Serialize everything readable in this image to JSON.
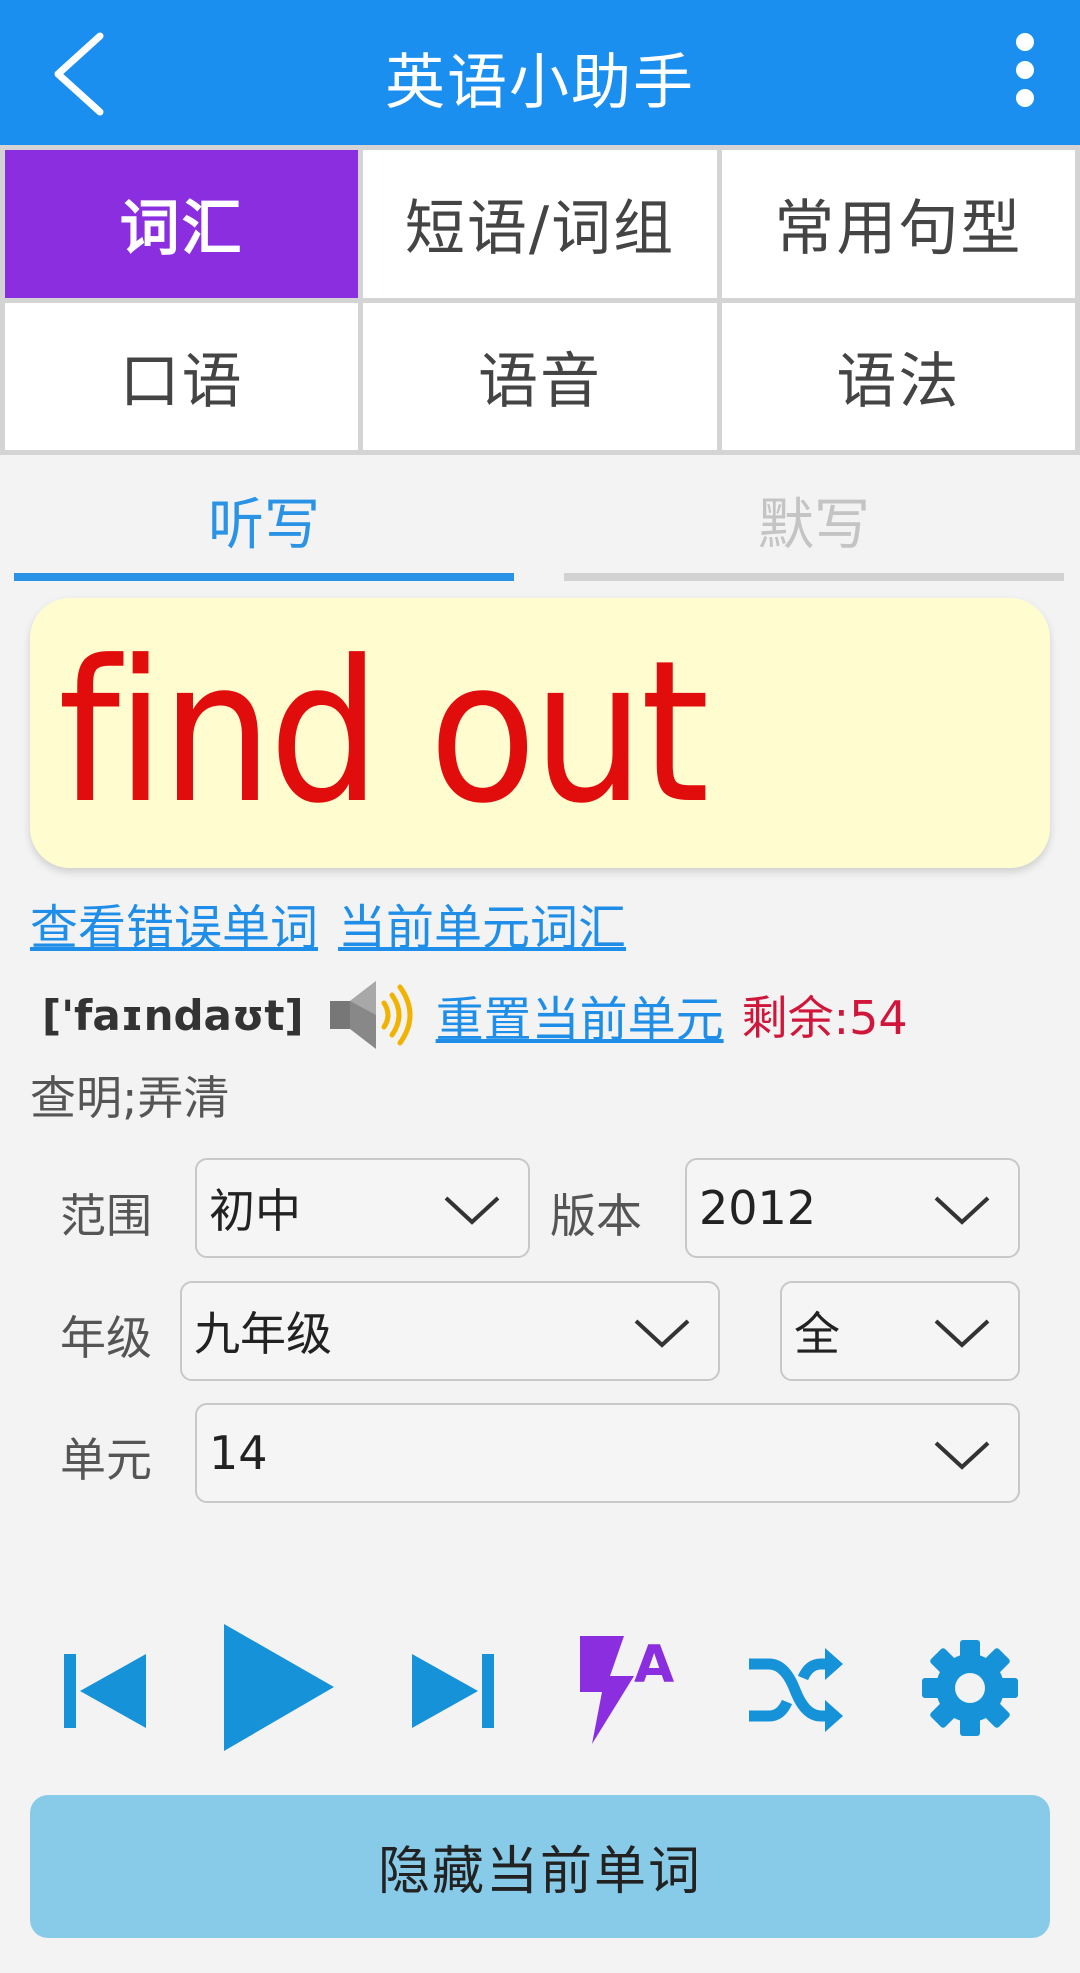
{
  "app": {
    "title": "英语小助手"
  },
  "icons": {
    "back": "chevron-left-icon",
    "more": "more-vertical-icon",
    "speaker": "speaker-icon",
    "prev": "skip-previous-icon",
    "play": "play-icon",
    "next": "skip-next-icon",
    "auto": "flash-auto-icon",
    "shuffle": "shuffle-icon",
    "settings": "gear-icon",
    "dropdown": "chevron-down-icon"
  },
  "colors": {
    "primary": "#1a8ff0",
    "active_category": "#8a2ee0",
    "word": "#e10c0c",
    "remaining": "#d0173b",
    "hide_button": "#87cbe8"
  },
  "categories": [
    {
      "label": "词汇",
      "active": true
    },
    {
      "label": "短语/词组",
      "active": false
    },
    {
      "label": "常用句型",
      "active": false
    },
    {
      "label": "口语",
      "active": false
    },
    {
      "label": "语音",
      "active": false
    },
    {
      "label": "语法",
      "active": false
    }
  ],
  "tabs": [
    {
      "label": "听写",
      "active": true
    },
    {
      "label": "默写",
      "active": false
    }
  ],
  "word": {
    "text": "find out",
    "phonetic": "['faɪndaʊt]",
    "meaning": "查明;弄清"
  },
  "links": {
    "wrong_words": "查看错误单词",
    "unit_vocab": "当前单元词汇",
    "reset_unit": "重置当前单元"
  },
  "remaining": "剩余:54",
  "filters": {
    "range": {
      "label": "范围",
      "value": "初中"
    },
    "version": {
      "label": "版本",
      "value": "2012"
    },
    "grade": {
      "label": "年级",
      "value": "九年级"
    },
    "term": {
      "value": "全"
    },
    "unit": {
      "label": "单元",
      "value": "14"
    }
  },
  "hide_button": "隐藏当前单词"
}
